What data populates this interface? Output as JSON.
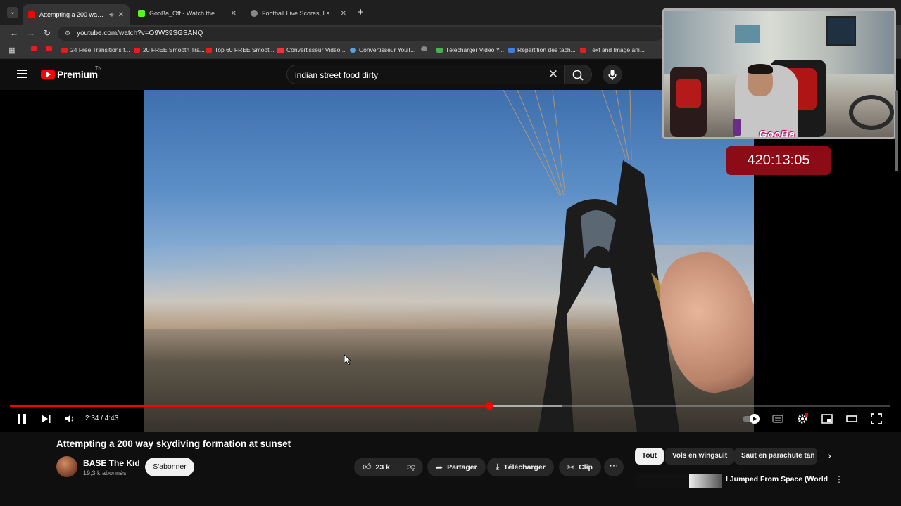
{
  "browser": {
    "tabs": [
      {
        "title": "Attempting a 200 way skyd",
        "active": true,
        "favicon_color": "#ff0000"
      },
      {
        "title": "GooBa_Off - Watch the VOD or",
        "active": false,
        "favicon_color": "#53fc18"
      },
      {
        "title": "Football Live Scores, Latest Foo",
        "active": false,
        "favicon_color": "#888888"
      }
    ],
    "url": "youtube.com/watch?v=O9W39SGSANQ",
    "bookmarks": [
      "24 Free Transitions f...",
      "20 FREE Smooth Tra...",
      "Top 60 FREE Smoot...",
      "Convertisseur Video...",
      "Convertisseur YouT...",
      "Télécharger Vidéo Y...",
      "Repartition des tach...",
      "Text and Image ani..."
    ]
  },
  "header": {
    "logo_text": "Premium",
    "region": "TN",
    "search_query": "indian street food dirty"
  },
  "player": {
    "time": "2:34 / 4:43",
    "progress": 0.545,
    "buffered": 0.628
  },
  "overlay": {
    "brand": "GooBa",
    "timer": "420:13:05"
  },
  "video": {
    "title": "Attempting a 200 way skydiving formation at sunset",
    "channel": "BASE The Kid",
    "subscribers": "19,3 k abonnés",
    "subscribe_label": "S'abonner",
    "likes": "23 k",
    "share_label": "Partager",
    "download_label": "Télécharger",
    "clip_label": "Clip"
  },
  "chips": [
    "Tout",
    "Vols en wingsuit",
    "Saut en parachute tan"
  ],
  "related": {
    "title": "I Jumped From Space (World"
  },
  "colors": {
    "accent": "#ff0000",
    "timer_bg": "#8b0c16"
  }
}
